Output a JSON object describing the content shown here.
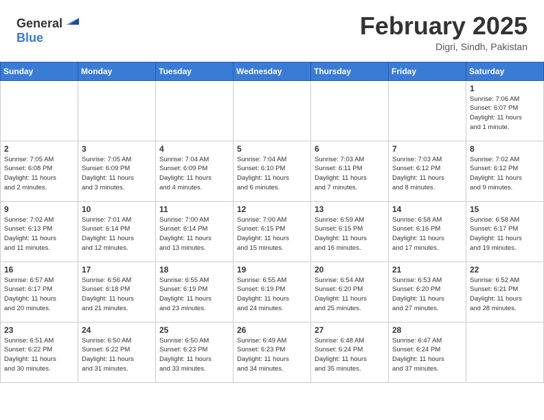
{
  "header": {
    "logo_general": "General",
    "logo_blue": "Blue",
    "month": "February 2025",
    "location": "Digri, Sindh, Pakistan"
  },
  "weekdays": [
    "Sunday",
    "Monday",
    "Tuesday",
    "Wednesday",
    "Thursday",
    "Friday",
    "Saturday"
  ],
  "weeks": [
    [
      {
        "day": "",
        "info": ""
      },
      {
        "day": "",
        "info": ""
      },
      {
        "day": "",
        "info": ""
      },
      {
        "day": "",
        "info": ""
      },
      {
        "day": "",
        "info": ""
      },
      {
        "day": "",
        "info": ""
      },
      {
        "day": "1",
        "info": "Sunrise: 7:06 AM\nSunset: 6:07 PM\nDaylight: 11 hours\nand 1 minute."
      }
    ],
    [
      {
        "day": "2",
        "info": "Sunrise: 7:05 AM\nSunset: 6:08 PM\nDaylight: 11 hours\nand 2 minutes."
      },
      {
        "day": "3",
        "info": "Sunrise: 7:05 AM\nSunset: 6:09 PM\nDaylight: 11 hours\nand 3 minutes."
      },
      {
        "day": "4",
        "info": "Sunrise: 7:04 AM\nSunset: 6:09 PM\nDaylight: 11 hours\nand 4 minutes."
      },
      {
        "day": "5",
        "info": "Sunrise: 7:04 AM\nSunset: 6:10 PM\nDaylight: 11 hours\nand 6 minutes."
      },
      {
        "day": "6",
        "info": "Sunrise: 7:03 AM\nSunset: 6:11 PM\nDaylight: 11 hours\nand 7 minutes."
      },
      {
        "day": "7",
        "info": "Sunrise: 7:03 AM\nSunset: 6:12 PM\nDaylight: 11 hours\nand 8 minutes."
      },
      {
        "day": "8",
        "info": "Sunrise: 7:02 AM\nSunset: 6:12 PM\nDaylight: 11 hours\nand 9 minutes."
      }
    ],
    [
      {
        "day": "9",
        "info": "Sunrise: 7:02 AM\nSunset: 6:13 PM\nDaylight: 11 hours\nand 11 minutes."
      },
      {
        "day": "10",
        "info": "Sunrise: 7:01 AM\nSunset: 6:14 PM\nDaylight: 11 hours\nand 12 minutes."
      },
      {
        "day": "11",
        "info": "Sunrise: 7:00 AM\nSunset: 6:14 PM\nDaylight: 11 hours\nand 13 minutes."
      },
      {
        "day": "12",
        "info": "Sunrise: 7:00 AM\nSunset: 6:15 PM\nDaylight: 11 hours\nand 15 minutes."
      },
      {
        "day": "13",
        "info": "Sunrise: 6:59 AM\nSunset: 6:15 PM\nDaylight: 11 hours\nand 16 minutes."
      },
      {
        "day": "14",
        "info": "Sunrise: 6:58 AM\nSunset: 6:16 PM\nDaylight: 11 hours\nand 17 minutes."
      },
      {
        "day": "15",
        "info": "Sunrise: 6:58 AM\nSunset: 6:17 PM\nDaylight: 11 hours\nand 19 minutes."
      }
    ],
    [
      {
        "day": "16",
        "info": "Sunrise: 6:57 AM\nSunset: 6:17 PM\nDaylight: 11 hours\nand 20 minutes."
      },
      {
        "day": "17",
        "info": "Sunrise: 6:56 AM\nSunset: 6:18 PM\nDaylight: 11 hours\nand 21 minutes."
      },
      {
        "day": "18",
        "info": "Sunrise: 6:55 AM\nSunset: 6:19 PM\nDaylight: 11 hours\nand 23 minutes."
      },
      {
        "day": "19",
        "info": "Sunrise: 6:55 AM\nSunset: 6:19 PM\nDaylight: 11 hours\nand 24 minutes."
      },
      {
        "day": "20",
        "info": "Sunrise: 6:54 AM\nSunset: 6:20 PM\nDaylight: 11 hours\nand 25 minutes."
      },
      {
        "day": "21",
        "info": "Sunrise: 6:53 AM\nSunset: 6:20 PM\nDaylight: 11 hours\nand 27 minutes."
      },
      {
        "day": "22",
        "info": "Sunrise: 6:52 AM\nSunset: 6:21 PM\nDaylight: 11 hours\nand 28 minutes."
      }
    ],
    [
      {
        "day": "23",
        "info": "Sunrise: 6:51 AM\nSunset: 6:22 PM\nDaylight: 11 hours\nand 30 minutes."
      },
      {
        "day": "24",
        "info": "Sunrise: 6:50 AM\nSunset: 6:22 PM\nDaylight: 11 hours\nand 31 minutes."
      },
      {
        "day": "25",
        "info": "Sunrise: 6:50 AM\nSunset: 6:23 PM\nDaylight: 11 hours\nand 33 minutes."
      },
      {
        "day": "26",
        "info": "Sunrise: 6:49 AM\nSunset: 6:23 PM\nDaylight: 11 hours\nand 34 minutes."
      },
      {
        "day": "27",
        "info": "Sunrise: 6:48 AM\nSunset: 6:24 PM\nDaylight: 11 hours\nand 35 minutes."
      },
      {
        "day": "28",
        "info": "Sunrise: 6:47 AM\nSunset: 6:24 PM\nDaylight: 11 hours\nand 37 minutes."
      },
      {
        "day": "",
        "info": ""
      }
    ]
  ]
}
